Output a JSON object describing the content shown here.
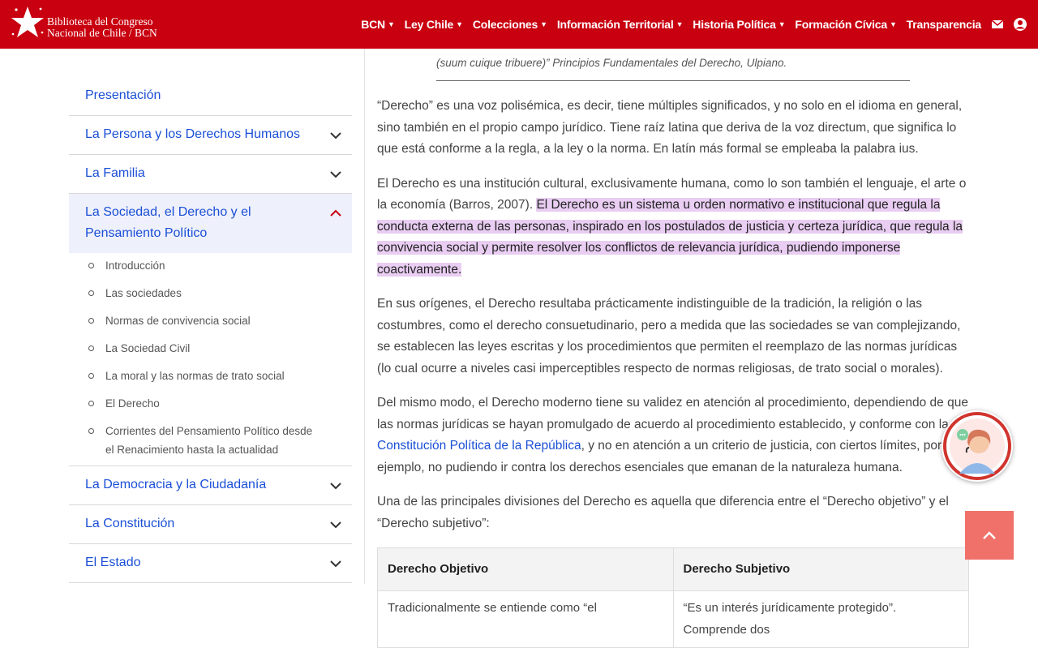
{
  "header": {
    "logo_line1": "Biblioteca del Congreso",
    "logo_line2": "Nacional de Chile / BCN",
    "nav": [
      {
        "label": "BCN",
        "caret": true
      },
      {
        "label": "Ley Chile",
        "caret": true
      },
      {
        "label": "Colecciones",
        "caret": true
      },
      {
        "label": "Información Territorial",
        "caret": true
      },
      {
        "label": "Historia Política",
        "caret": true
      },
      {
        "label": "Formación Cívica",
        "caret": true
      },
      {
        "label": "Transparencia",
        "caret": false
      }
    ],
    "icons": [
      "envelope-icon",
      "user-circle-icon"
    ],
    "brand_color": "#c8000f"
  },
  "sidebar": {
    "items": [
      {
        "label": "Presentación"
      },
      {
        "label": "La Persona y los Derechos Humanos"
      },
      {
        "label": "La Familia"
      },
      {
        "label": "La Sociedad, el Derecho y el Pensamiento Político"
      },
      {
        "label": "La Democracia y la Ciudadanía"
      },
      {
        "label": "La Constitución"
      },
      {
        "label": "El Estado"
      }
    ],
    "subitems": [
      "Introducción",
      "Las sociedades",
      "Normas de convivencia social",
      "La Sociedad Civil",
      "La moral y las normas de trato social",
      "El Derecho",
      "Corrientes del Pensamiento Político desde el Renacimiento hasta la actualidad"
    ],
    "link_color": "#1a4fd6"
  },
  "main": {
    "quote_line1": "(suum cuique tribuere)” Principios Fundamentales del Derecho, Ulpiano.",
    "p1": "“Derecho” es una voz polisémica, es decir, tiene múltiples significados, y no solo en el idioma en general, sino también en el propio campo jurídico. Tiene raíz latina que deriva de la voz directum, que significa lo que está conforme a la regla, a la ley o la norma. En latín más formal se empleaba la palabra ius.",
    "p2_start": "El Derecho es una institución cultural, exclusivamente humana, como lo son también el lenguaje, el arte o la economía (Barros, 2007). ",
    "p2_highlight": "El Derecho es un sistema u orden normativo e institucional que regula la conducta externa de las personas, inspirado en los postulados de justicia y certeza jurídica, que regula la convivencia social y permite resolver los conflictos de relevancia jurídica, pudiendo imponerse coactivamente.",
    "p3": "En sus orígenes, el Derecho resultaba prácticamente indistinguible de la tradición, la religión o las costumbres, como el derecho consuetudinario, pero a medida que las sociedades se van complejizando, se establecen las leyes escritas y los procedimientos que permiten el reemplazo de las normas jurídicas (lo cual ocurre a niveles casi imperceptibles respecto de normas religiosas, de trato social o morales).",
    "p4_start": "Del mismo modo, el Derecho moderno tiene su validez en atención al procedimiento, dependiendo de que las normas jurídicas se hayan promulgado de acuerdo al procedimiento establecido, y conforme con la ",
    "p4_link": "Constitución Política de la República",
    "p4_end": ", y no en atención a un criterio de justicia, con ciertos límites, por ejemplo, no pudiendo ir contra los derechos esenciales que emanan de la naturaleza humana.",
    "p5": "Una de las principales divisiones del Derecho es aquella que diferencia entre el “Derecho objetivo” y el “Derecho subjetivo”:",
    "table": {
      "headers": [
        "Derecho Objetivo",
        "Derecho Subjetivo"
      ],
      "row1": [
        "Tradicionalmente se entiende como “el",
        "“Es un interés jurídicamente protegido”. Comprende dos"
      ]
    },
    "highlight_color": "#e9cdf2"
  },
  "floating": {
    "assistant_icon": "virtual-assistant-icon",
    "to_top_icon": "chevron-up-icon",
    "to_top_color": "#f0706a"
  }
}
